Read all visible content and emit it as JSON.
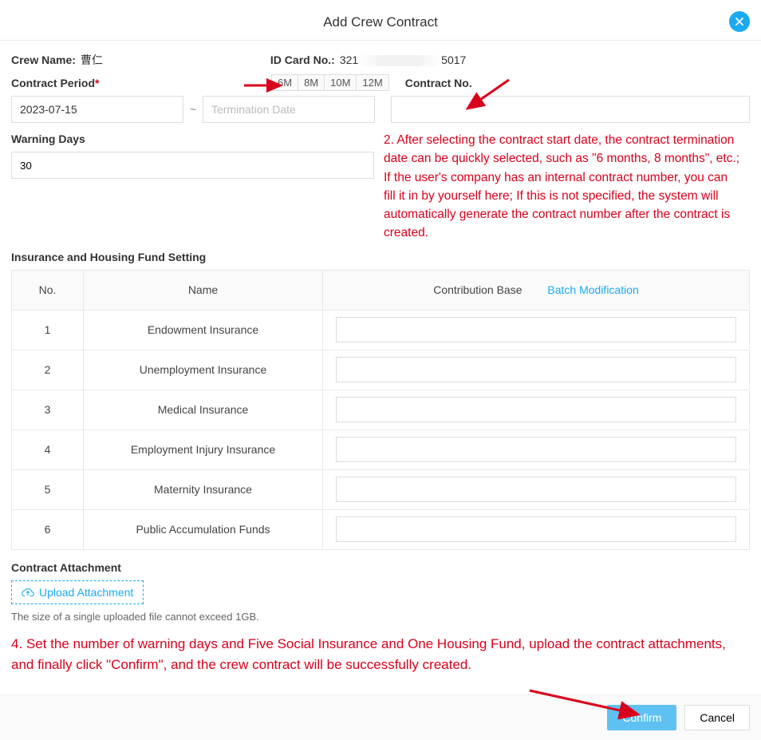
{
  "dialog": {
    "title": "Add Crew Contract"
  },
  "info": {
    "crew_name_label": "Crew Name:",
    "crew_name_value": "曹仁",
    "id_label": "ID Card No.:",
    "id_prefix": "321",
    "id_suffix": "5017"
  },
  "period": {
    "label": "Contract Period",
    "btns": [
      "6M",
      "8M",
      "10M",
      "12M"
    ],
    "contract_no_label": "Contract No.",
    "start_date": "2023-07-15",
    "term_placeholder": "Termination Date"
  },
  "warning": {
    "label": "Warning Days",
    "value": "30"
  },
  "annotation2": "2. After selecting the contract start date, the contract termination date can be quickly selected, such as \"6 months, 8 months\", etc.; If the user's company has an internal contract number, you can fill it in by yourself here; If this is not specified, the system will automatically generate the contract number after the contract is created.",
  "insurance": {
    "heading": "Insurance and Housing Fund Setting",
    "headers": {
      "no": "No.",
      "name": "Name",
      "base": "Contribution Base",
      "batch": "Batch Modification"
    },
    "rows": [
      {
        "no": "1",
        "name": "Endowment Insurance"
      },
      {
        "no": "2",
        "name": "Unemployment Insurance"
      },
      {
        "no": "3",
        "name": "Medical Insurance"
      },
      {
        "no": "4",
        "name": "Employment Injury Insurance"
      },
      {
        "no": "5",
        "name": "Maternity Insurance"
      },
      {
        "no": "6",
        "name": "Public Accumulation Funds"
      }
    ]
  },
  "attach": {
    "heading": "Contract Attachment",
    "upload": "Upload Attachment",
    "note": "The size of a single uploaded file cannot exceed 1GB."
  },
  "annotation4": "4. Set the number of warning days and Five Social Insurance and One Housing Fund, upload the contract attachments, and finally click \"Confirm\", and the crew contract will be successfully created.",
  "footer": {
    "confirm": "Confirm",
    "cancel": "Cancel"
  }
}
